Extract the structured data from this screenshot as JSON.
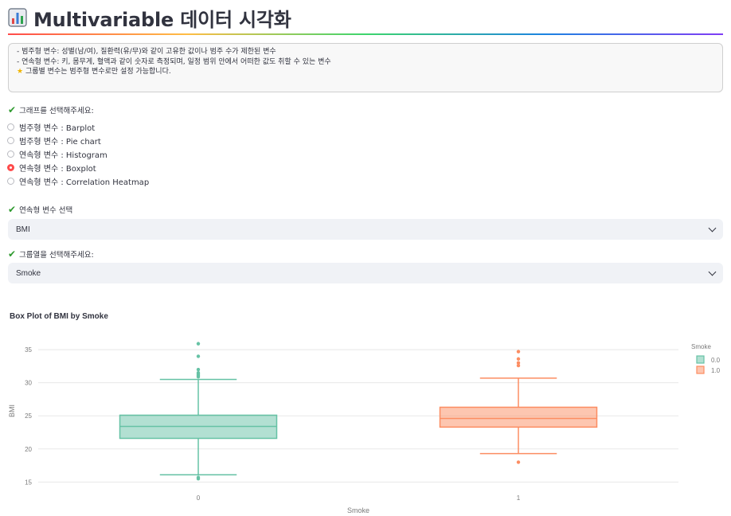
{
  "header": {
    "title": "Multivariable 데이터 시각화",
    "icon": "bar-chart-icon"
  },
  "info": {
    "line1": "- 범주형 변수: 성별(남/여), 질환력(유/무)와 같이 고유한 값이나 범주 수가 제한된 변수",
    "line2": "- 연속형 변수: 키, 몸무게, 혈액과 같이 숫자로 측정되며, 일정 범위 안에서 어떠한 값도 취할 수 있는 변수",
    "line3": "그룹별 변수는 범주형 변수로만 설정 가능합니다."
  },
  "graph_select": {
    "label": "그래프를 선택해주세요:",
    "options": [
      "범주형 변수 : Barplot",
      "범주형 변수 : Pie chart",
      "연속형 변수 : Histogram",
      "연속형 변수 : Boxplot",
      "연속형 변수 : Correlation Heatmap"
    ],
    "selected_index": 3
  },
  "variable_select": {
    "label": "연속형 변수 선택",
    "value": "BMI"
  },
  "group_select": {
    "label": "그룹열을 선택해주세요:",
    "value": "Smoke"
  },
  "colors": {
    "series0": "#66c2a5",
    "series1": "#fc8d62",
    "accent": "#ff4b4b"
  },
  "chart_data": {
    "type": "box",
    "title": "Box Plot of BMI by Smoke",
    "xlabel": "Smoke",
    "ylabel": "BMI",
    "categories": [
      "0",
      "1"
    ],
    "yticks": [
      15,
      20,
      25,
      30,
      35
    ],
    "ylim": [
      14.2,
      37.3
    ],
    "grid": true,
    "legend": {
      "title": "Smoke",
      "position": "top-right",
      "entries": [
        "0.0",
        "1.0"
      ]
    },
    "series": [
      {
        "name": "0.0",
        "category": "0",
        "min": 16.1,
        "q1": 21.6,
        "median": 23.4,
        "q3": 25.1,
        "max": 30.5,
        "outliers": [
          35.9,
          34.0,
          32.0,
          31.5,
          31.3,
          31.1,
          30.9,
          15.7,
          15.5
        ]
      },
      {
        "name": "1.0",
        "category": "1",
        "min": 19.3,
        "q1": 23.3,
        "median": 24.6,
        "q3": 26.3,
        "max": 30.7,
        "outliers": [
          34.7,
          33.6,
          33.0,
          32.6,
          18.0
        ]
      }
    ]
  }
}
